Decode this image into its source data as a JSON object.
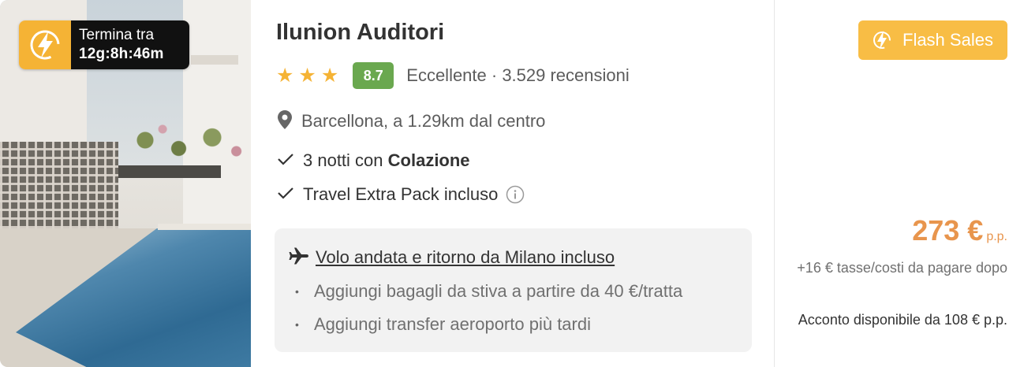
{
  "timer": {
    "label": "Termina tra",
    "countdown": "12g:8h:46m"
  },
  "hotel": {
    "name": "Ilunion Auditori",
    "star_count": 3,
    "score": "8.7",
    "review_summary": "Eccellente · 3.529 recensioni",
    "location": "Barcellona, a 1.29km dal centro"
  },
  "features": {
    "nights_prefix": "3 notti con ",
    "nights_bold": "Colazione",
    "extra_pack": "Travel Extra Pack incluso"
  },
  "flight": {
    "title": "Volo andata e ritorno da Milano incluso",
    "bullets": [
      "Aggiungi bagagli da stiva a partire da 40 €/tratta",
      "Aggiungi transfer aeroporto più tardi"
    ]
  },
  "badge": {
    "label": "Flash Sales"
  },
  "price": {
    "amount": "273 €",
    "unit": "p.p.",
    "taxes": "+16 € tasse/costi da pagare dopo",
    "deposit": "Acconto disponibile da 108 € p.p."
  },
  "colors": {
    "accent_orange": "#f5b335",
    "price_orange": "#e8954d",
    "score_green": "#6aa84f"
  },
  "icons": [
    "lightning-icon",
    "star-icon",
    "map-pin-icon",
    "check-icon",
    "info-icon",
    "plane-icon"
  ]
}
